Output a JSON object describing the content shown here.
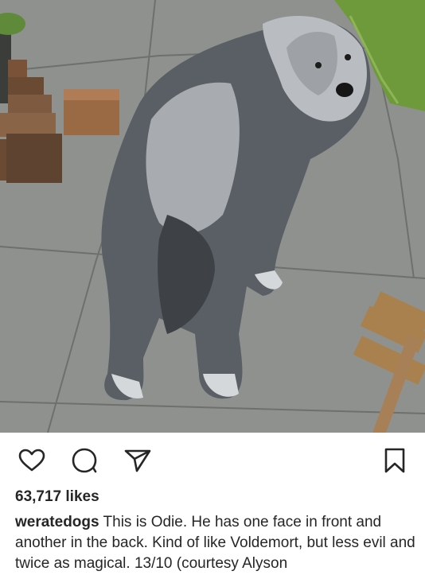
{
  "post": {
    "image": {
      "subject": "dog-on-patio",
      "colors": {
        "patio": "#8f918e",
        "wood": "#8a5a3a",
        "grass": "#6f9a3c",
        "fur_dark": "#3e4247",
        "fur_light": "#c9ccd0"
      }
    },
    "actions": {
      "like_icon": "heart-icon",
      "comment_icon": "comment-icon",
      "share_icon": "send-icon",
      "save_icon": "bookmark-icon"
    },
    "likes_text": "63,717 likes",
    "caption": {
      "username": "weratedogs",
      "text": "This is Odie. He has one face in front and another in the back. Kind of like Voldemort, but less evil and twice as magical. 13/10 (courtesy Alyson"
    }
  }
}
